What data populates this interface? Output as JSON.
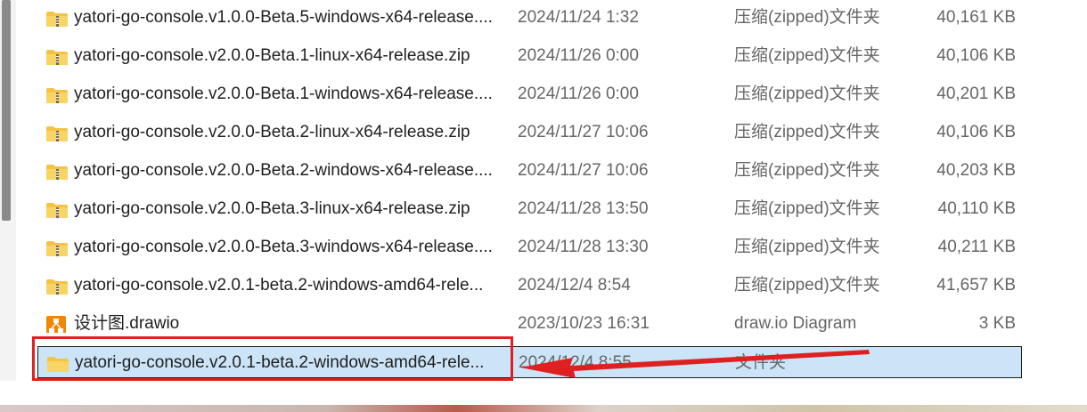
{
  "files": [
    {
      "name": "yatori-go-console.v1.0.0-Beta.5-windows-x64-release....",
      "date": "2024/11/24 1:32",
      "type": "压缩(zipped)文件夹",
      "size": "40,161 KB",
      "icon": "zip-folder-icon"
    },
    {
      "name": "yatori-go-console.v2.0.0-Beta.1-linux-x64-release.zip",
      "date": "2024/11/26 0:00",
      "type": "压缩(zipped)文件夹",
      "size": "40,106 KB",
      "icon": "zip-folder-icon"
    },
    {
      "name": "yatori-go-console.v2.0.0-Beta.1-windows-x64-release....",
      "date": "2024/11/26 0:00",
      "type": "压缩(zipped)文件夹",
      "size": "40,201 KB",
      "icon": "zip-folder-icon"
    },
    {
      "name": "yatori-go-console.v2.0.0-Beta.2-linux-x64-release.zip",
      "date": "2024/11/27 10:06",
      "type": "压缩(zipped)文件夹",
      "size": "40,106 KB",
      "icon": "zip-folder-icon"
    },
    {
      "name": "yatori-go-console.v2.0.0-Beta.2-windows-x64-release....",
      "date": "2024/11/27 10:06",
      "type": "压缩(zipped)文件夹",
      "size": "40,203 KB",
      "icon": "zip-folder-icon"
    },
    {
      "name": "yatori-go-console.v2.0.0-Beta.3-linux-x64-release.zip",
      "date": "2024/11/28 13:50",
      "type": "压缩(zipped)文件夹",
      "size": "40,110 KB",
      "icon": "zip-folder-icon"
    },
    {
      "name": "yatori-go-console.v2.0.0-Beta.3-windows-x64-release....",
      "date": "2024/11/28 13:30",
      "type": "压缩(zipped)文件夹",
      "size": "40,211 KB",
      "icon": "zip-folder-icon"
    },
    {
      "name": "yatori-go-console.v2.0.1-beta.2-windows-amd64-rele...",
      "date": "2024/12/4 8:54",
      "type": "压缩(zipped)文件夹",
      "size": "41,657 KB",
      "icon": "zip-folder-icon"
    },
    {
      "name": "设计图.drawio",
      "date": "2023/10/23 16:31",
      "type": "draw.io Diagram",
      "size": "3 KB",
      "icon": "drawio-icon"
    },
    {
      "name": "yatori-go-console.v2.0.1-beta.2-windows-amd64-rele...",
      "date": "2024/12/4 8:55",
      "type": "文件夹",
      "size": "",
      "icon": "folder-icon",
      "selected": true
    }
  ],
  "colors": {
    "selection": "#cce4f7",
    "annotation": "#e02020",
    "folder": "#f5c342",
    "drawio": "#f08705"
  }
}
